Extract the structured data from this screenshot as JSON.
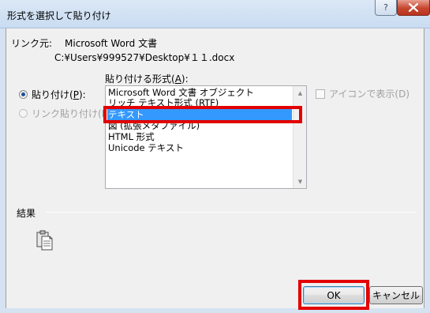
{
  "window": {
    "title": "形式を選択して貼り付け",
    "help_glyph": "?",
    "close_icon": "close-icon"
  },
  "source": {
    "label": "リンク元:",
    "name": "Microsoft Word 文書",
    "path": "C:¥Users¥999527¥Desktop¥１１.docx"
  },
  "paste_options": {
    "paste": {
      "label": "貼り付け(",
      "key": "P",
      "suffix": "):",
      "checked": true
    },
    "paste_link": {
      "label": "リンク貼り付け(L):",
      "checked": false,
      "disabled": true
    }
  },
  "as": {
    "label": "貼り付ける形式(",
    "key": "A",
    "suffix": "):",
    "items": [
      "Microsoft Word 文書 オブジェクト",
      "リッチ テキスト形式 (RTF)",
      "テキスト",
      "図 (拡張メタファイル)",
      "HTML 形式",
      "Unicode テキスト"
    ],
    "selected_index": 2
  },
  "display_as_icon": {
    "label": "アイコンで表示(D)",
    "checked": false
  },
  "result": {
    "label": "結果",
    "icon": "clipboard-paste-icon"
  },
  "buttons": {
    "ok": "OK",
    "cancel": "キャンセル"
  },
  "colors": {
    "highlight": "#e20000",
    "selection": "#3399ff"
  }
}
